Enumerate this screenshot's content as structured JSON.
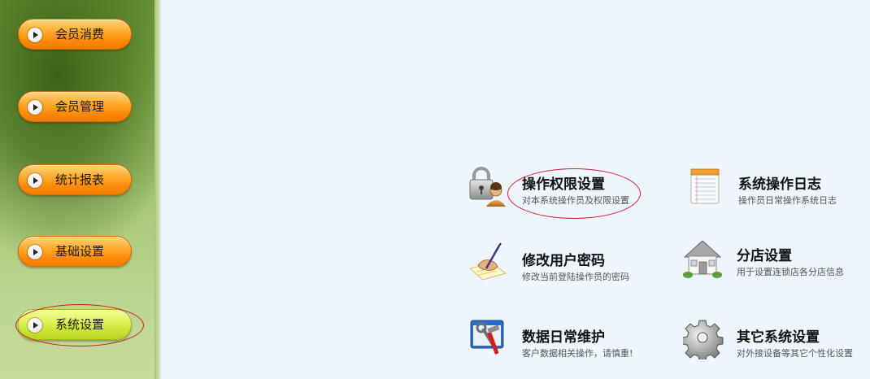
{
  "sidebar": {
    "items": [
      {
        "label": "会员消费",
        "active": false
      },
      {
        "label": "会员管理",
        "active": false
      },
      {
        "label": "统计报表",
        "active": false
      },
      {
        "label": "基础设置",
        "active": false
      },
      {
        "label": "系统设置",
        "active": true
      }
    ]
  },
  "tiles": [
    {
      "title": "操作权限设置",
      "desc": "对本系统操作员及权限设置",
      "icon": "lock-user-icon"
    },
    {
      "title": "系统操作日志",
      "desc": "操作员日常操作系统日志",
      "icon": "notepad-icon"
    },
    {
      "title": "修改用户密码",
      "desc": "修改当前登陆操作员的密码",
      "icon": "hand-writing-icon"
    },
    {
      "title": "分店设置",
      "desc": "用于设置连锁店各分店信息",
      "icon": "house-icon"
    },
    {
      "title": "数据日常维护",
      "desc": "客户数据相关操作，请慎重!",
      "icon": "tools-icon"
    },
    {
      "title": "其它系统设置",
      "desc": "对外接设备等其它个性化设置",
      "icon": "gear-icon"
    }
  ],
  "colors": {
    "nav_button": "#ff9a1a",
    "nav_button_active": "#d8ee4a",
    "highlight_ring": "#cf1a2a",
    "content_bg": "#eef5fd"
  }
}
